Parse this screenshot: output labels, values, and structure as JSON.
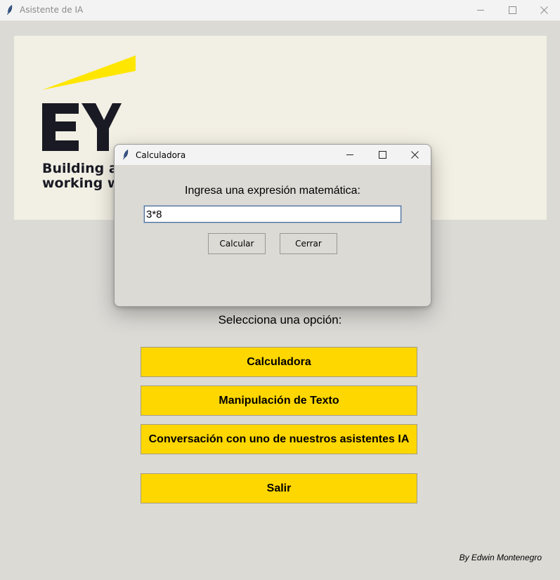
{
  "main_window": {
    "title": "Asistente de IA",
    "controls": {
      "minimize": "—",
      "maximize": "☐",
      "close": "✕"
    }
  },
  "banner": {
    "logo_text": "EY",
    "tagline": "Building a better\nworking world",
    "colors": {
      "accent": "#ffe600",
      "logo": "#1a1a24",
      "background": "#f2efe4"
    }
  },
  "prompt": "Selecciona una opción:",
  "options": [
    {
      "label": "Calculadora"
    },
    {
      "label": "Manipulación de Texto"
    },
    {
      "label": "Conversación con uno de nuestros asistentes IA"
    },
    {
      "label": "Salir"
    }
  ],
  "footer": "By Edwin Montenegro",
  "dialog": {
    "title": "Calculadora",
    "controls": {
      "minimize": "—",
      "maximize": "☐",
      "close": "✕"
    },
    "label": "Ingresa una expresión matemática:",
    "input_value": "3*8",
    "buttons": {
      "calculate": "Calcular",
      "close": "Cerrar"
    }
  },
  "colors": {
    "button_bg": "#ffd700",
    "window_bg": "#dcdad5"
  }
}
